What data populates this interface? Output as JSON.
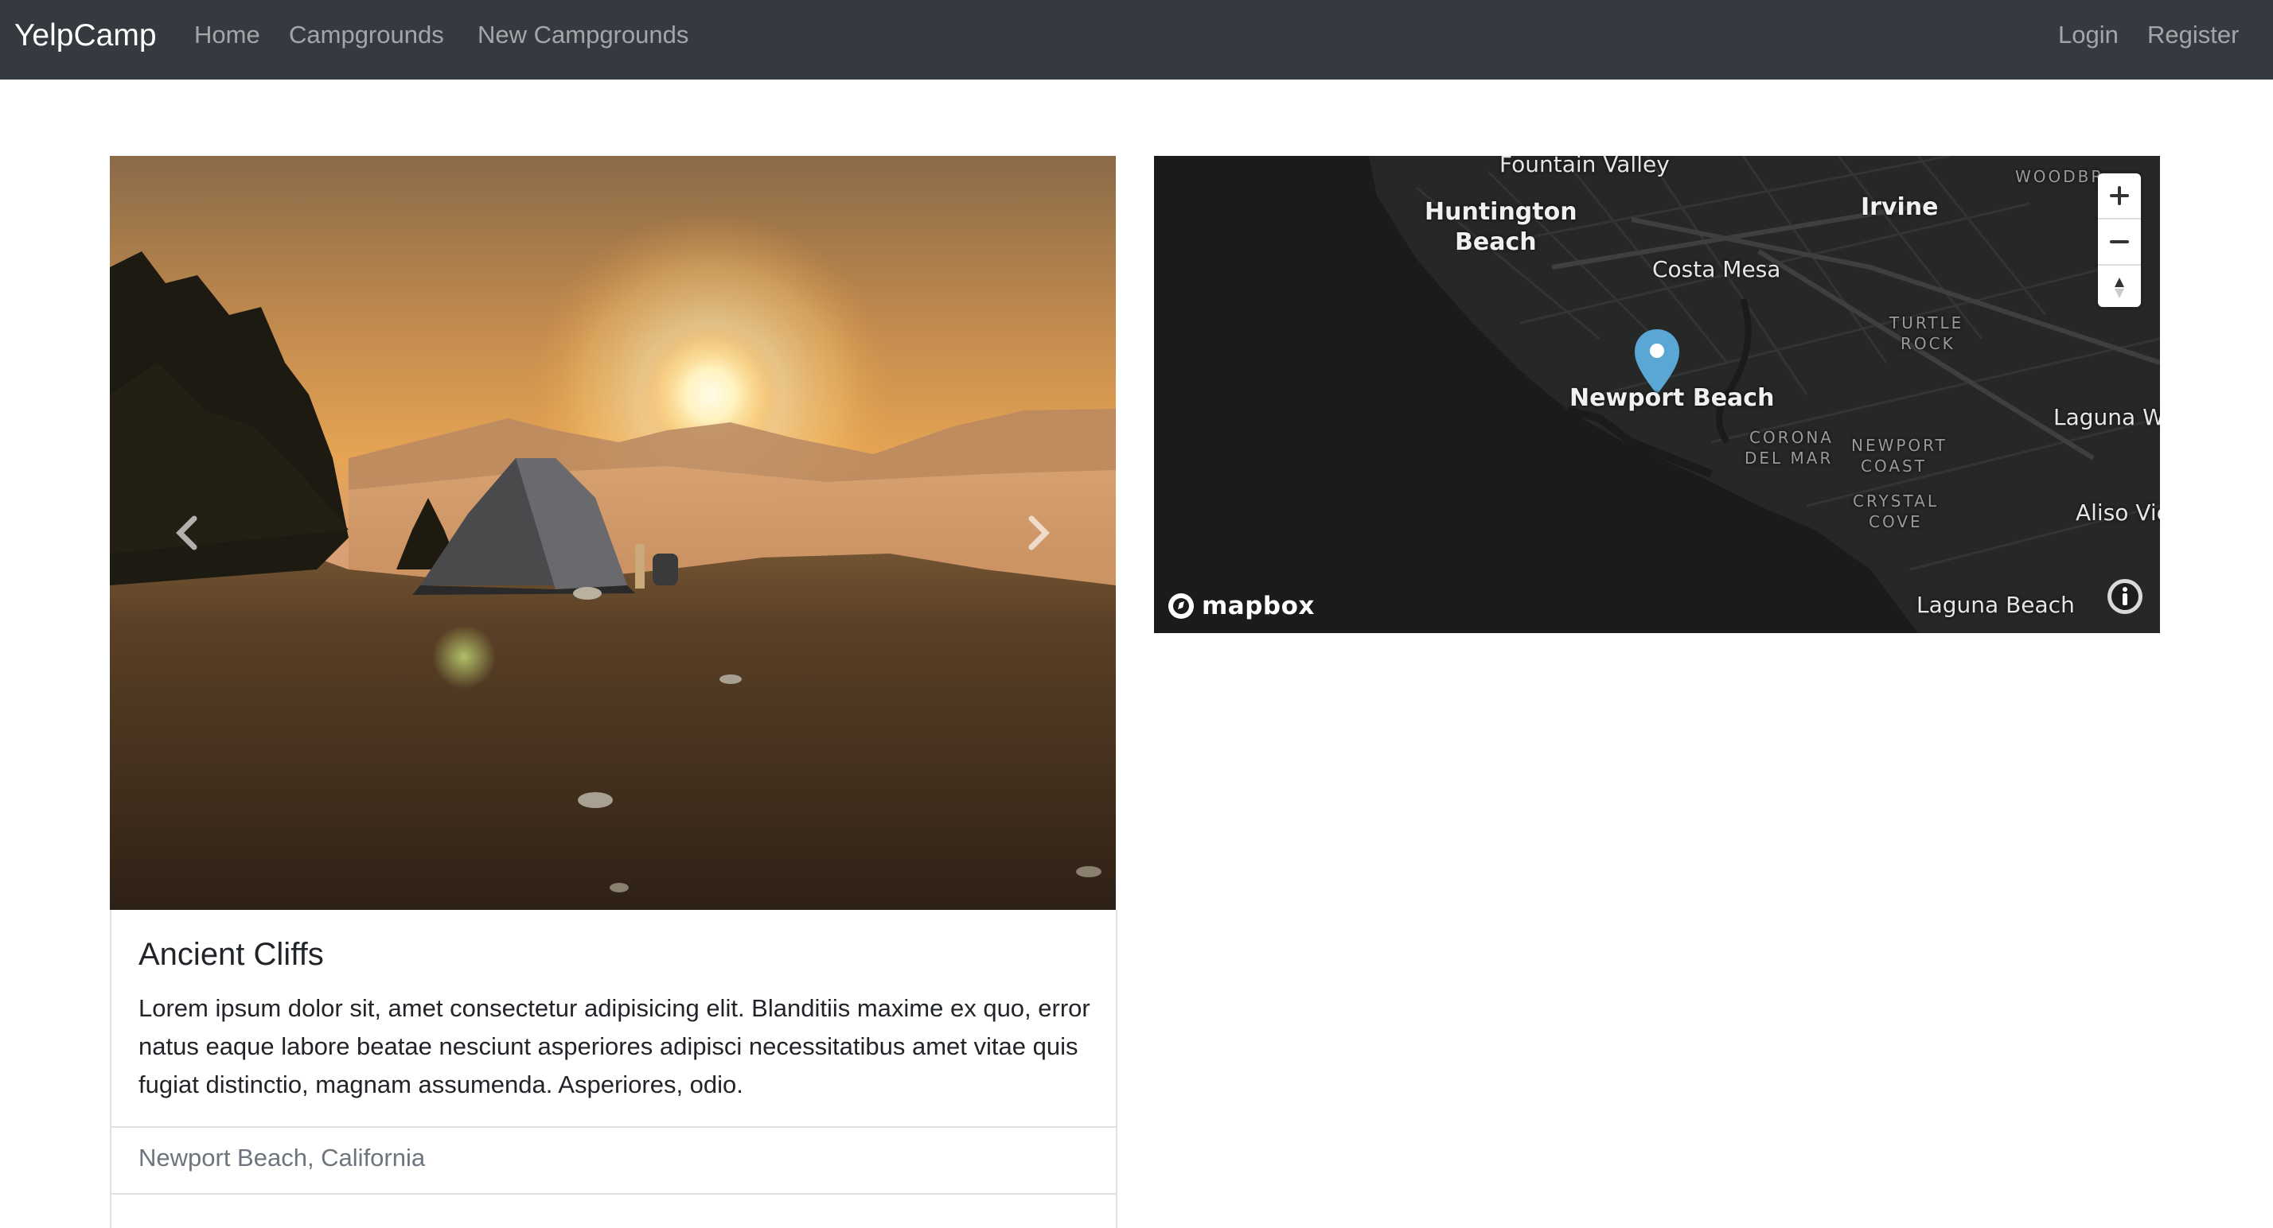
{
  "navbar": {
    "brand": "YelpCamp",
    "links": [
      {
        "label": "Home"
      },
      {
        "label": "Campgrounds"
      },
      {
        "label": "New Campgrounds"
      }
    ],
    "auth_links": [
      {
        "label": "Login"
      },
      {
        "label": "Register"
      }
    ]
  },
  "campground": {
    "title": "Ancient Cliffs",
    "description": "Lorem ipsum dolor sit, amet consectetur adipisicing elit. Blanditiis maxime ex quo, error natus eaque labore beatae nesciunt asperiores adipisci necessitatibus amet vitae quis fugiat distinctio, magnam assumenda. Asperiores, odio.",
    "location": "Newport Beach, California"
  },
  "carousel": {
    "prev_icon": "chevron-left-icon",
    "next_icon": "chevron-right-icon"
  },
  "map": {
    "places": {
      "fountain_valley": "Fountain Valley",
      "huntington_beach_1": "Huntington",
      "huntington_beach_2": "Beach",
      "irvine": "Irvine",
      "costa_mesa": "Costa Mesa",
      "woodbridge": "WOODBR",
      "turtle_rock_1": "TURTLE",
      "turtle_rock_2": "ROCK",
      "newport_beach": "Newport Beach",
      "corona_del_mar_1": "CORONA",
      "corona_del_mar_2": "DEL MAR",
      "newport_coast_1": "NEWPORT",
      "newport_coast_2": "COAST",
      "crystal_cove_1": "CRYSTAL",
      "crystal_cove_2": "COVE",
      "laguna_woods": "Laguna Wo",
      "aliso_viejo": "Aliso Vie",
      "laguna_beach": "Laguna Beach"
    },
    "attribution_logo": "mapbox",
    "controls": {
      "zoom_in_icon": "plus-icon",
      "zoom_out_icon": "minus-icon",
      "compass_icon": "compass-icon",
      "info_icon": "info-icon"
    },
    "colors": {
      "land": "#262727",
      "water": "#1a1b1b",
      "marker": "#5aa6d4"
    }
  },
  "colors": {
    "navbar_bg": "#343a40",
    "muted_text": "#6c757d"
  }
}
